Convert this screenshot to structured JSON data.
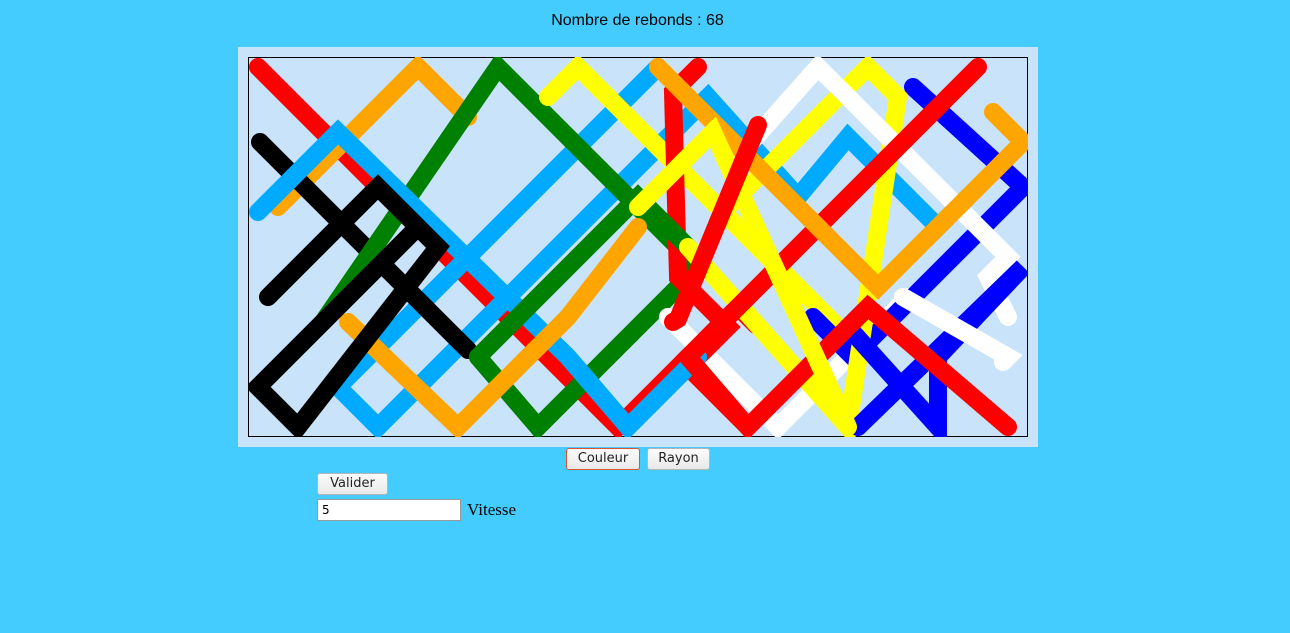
{
  "counter": {
    "label": "Nombre de rebonds : 68"
  },
  "controls": {
    "color_button": "Couleur",
    "ray_button": "Rayon",
    "validate_button": "Valider",
    "speed_value": "5",
    "speed_label": "Vitesse"
  },
  "canvas": {
    "background": "#c9e3fa",
    "frame": "#c9e3fa",
    "trail_palette": [
      "#ff0000",
      "#00aaff",
      "#ffa500",
      "#000000",
      "#008000",
      "#ffff00",
      "#ffffff",
      "#0000ff"
    ]
  }
}
